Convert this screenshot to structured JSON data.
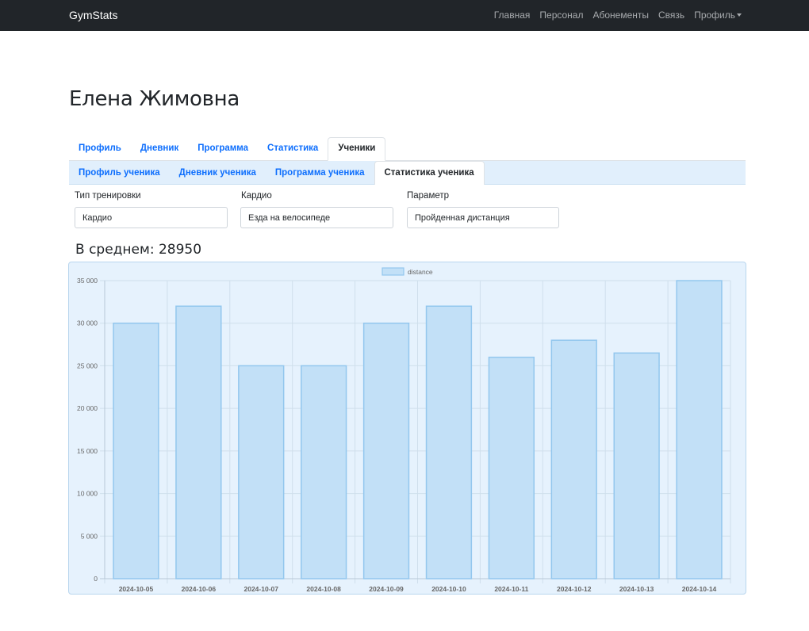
{
  "navbar": {
    "brand": "GymStats",
    "links": [
      "Главная",
      "Персонал",
      "Абонементы",
      "Связь",
      "Профиль"
    ]
  },
  "page_title": "Елена Жимовна",
  "tabs": [
    "Профиль",
    "Дневник",
    "Программа",
    "Статистика",
    "Ученики"
  ],
  "active_tab": "Ученики",
  "subtabs": [
    "Профиль ученика",
    "Дневник ученика",
    "Программа ученика",
    "Статистика ученика"
  ],
  "active_subtab": "Статистика ученика",
  "filters": {
    "workout_type": {
      "label": "Тип тренировки",
      "value": "Кардио"
    },
    "cardio": {
      "label": "Кардио",
      "value": "Езда на велосипеде"
    },
    "parameter": {
      "label": "Параметр",
      "value": "Пройденная дистанция"
    }
  },
  "average": "В среднем: 28950",
  "colors": {
    "navbar_bg": "#212529",
    "link_blue": "#0d6efd",
    "bar_fill": "#c2e0f7",
    "bar_stroke": "#93c7ee",
    "chart_bg": "#e6f2fd"
  },
  "chart_data": {
    "type": "bar",
    "categories": [
      "2024-10-05",
      "2024-10-06",
      "2024-10-07",
      "2024-10-08",
      "2024-10-09",
      "2024-10-10",
      "2024-10-11",
      "2024-10-12",
      "2024-10-13",
      "2024-10-14"
    ],
    "series": [
      {
        "name": "distance",
        "values": [
          30000,
          32000,
          25000,
          25000,
          30000,
          32000,
          26000,
          28000,
          26500,
          35000
        ]
      }
    ],
    "ylim": [
      0,
      35000
    ],
    "yticks": [
      0,
      5000,
      10000,
      15000,
      20000,
      25000,
      30000,
      35000
    ],
    "ytick_labels": [
      "0",
      "5 000",
      "10 000",
      "15 000",
      "20 000",
      "25 000",
      "30 000",
      "35 000"
    ],
    "legend_position": "top-center",
    "grid": true
  }
}
